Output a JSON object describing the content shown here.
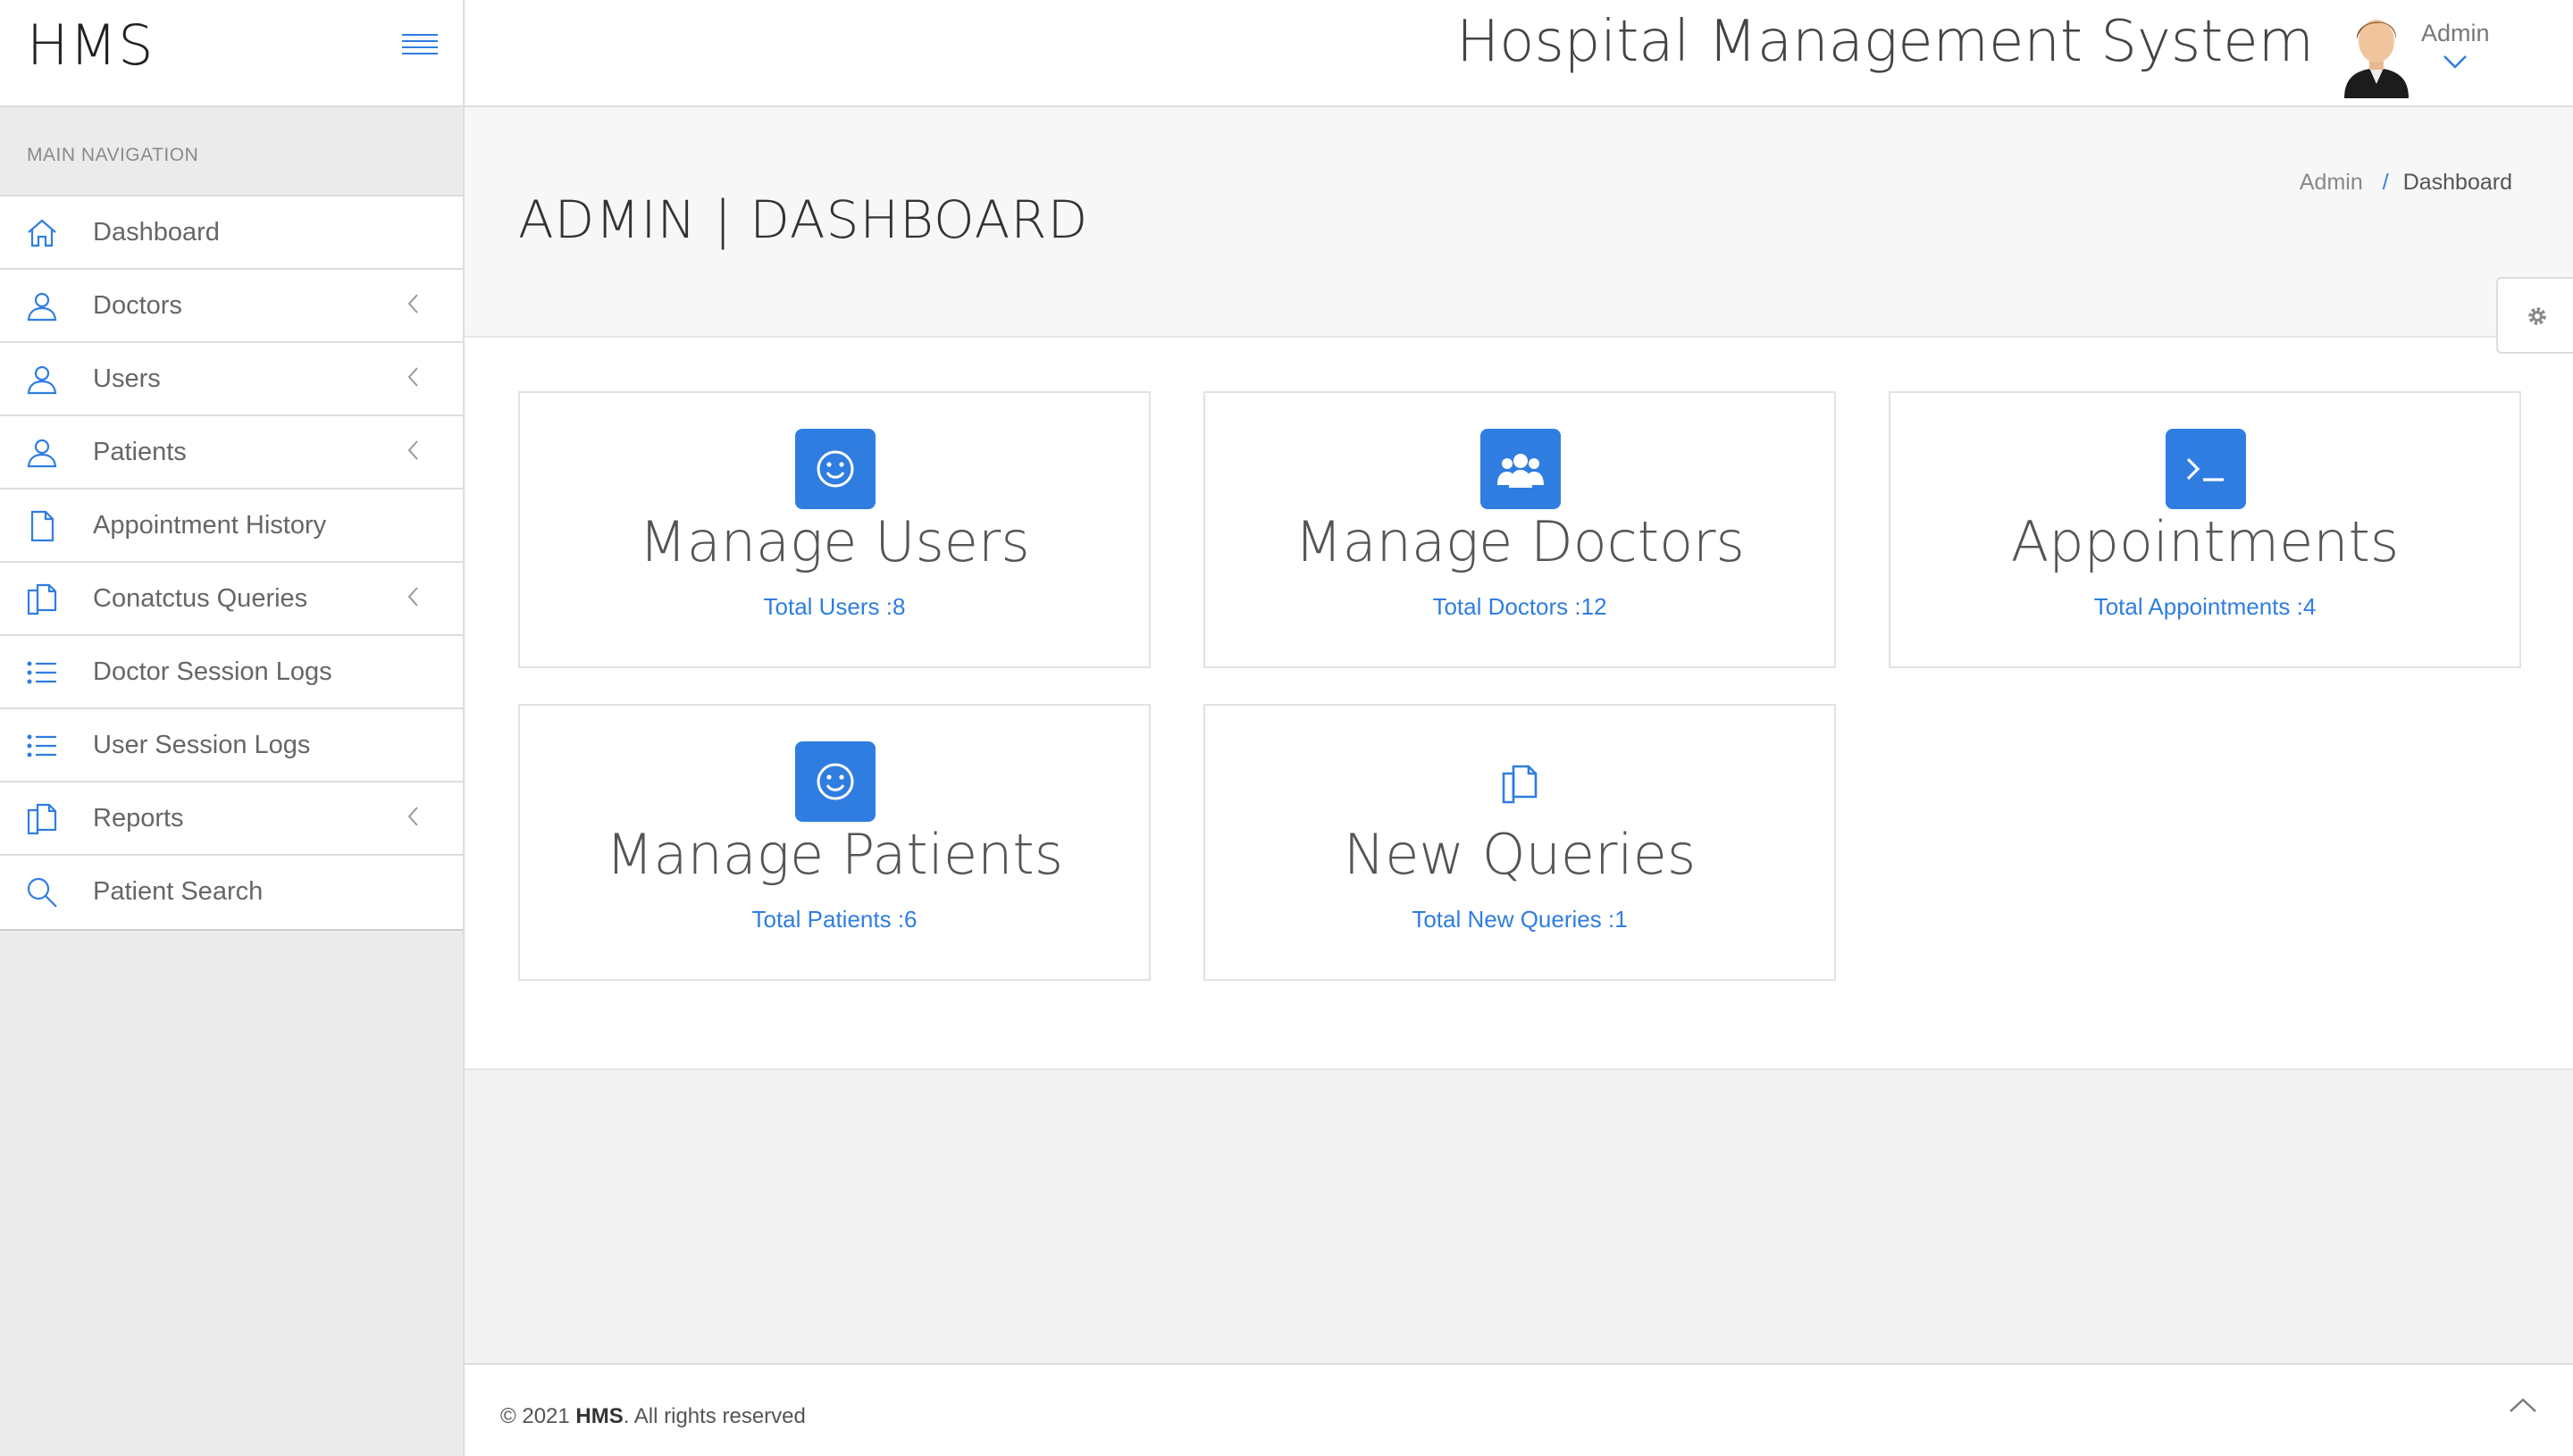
{
  "header": {
    "brand": "HMS",
    "system_title": "Hospital Management System",
    "user_name": "Admin"
  },
  "sidebar": {
    "section_title": "MAIN NAVIGATION",
    "items": [
      {
        "label": "Dashboard",
        "icon": "home-icon",
        "has_submenu": false
      },
      {
        "label": "Doctors",
        "icon": "user-icon",
        "has_submenu": true
      },
      {
        "label": "Users",
        "icon": "user-icon",
        "has_submenu": true
      },
      {
        "label": "Patients",
        "icon": "user-icon",
        "has_submenu": true
      },
      {
        "label": "Appointment History",
        "icon": "file-icon",
        "has_submenu": false
      },
      {
        "label": "Conatctus Queries",
        "icon": "files-icon",
        "has_submenu": true
      },
      {
        "label": "Doctor Session Logs",
        "icon": "list-icon",
        "has_submenu": false
      },
      {
        "label": "User Session Logs",
        "icon": "list-icon",
        "has_submenu": false
      },
      {
        "label": "Reports",
        "icon": "files-icon",
        "has_submenu": true
      },
      {
        "label": "Patient Search",
        "icon": "search-icon",
        "has_submenu": false
      }
    ]
  },
  "page": {
    "title": "ADMIN | DASHBOARD",
    "breadcrumb": [
      "Admin",
      "Dashboard"
    ]
  },
  "cards": [
    {
      "title": "Manage Users",
      "count_text": "Total Users :8",
      "icon": "smile-icon"
    },
    {
      "title": "Manage Doctors",
      "count_text": "Total Doctors :12",
      "icon": "users-group-icon"
    },
    {
      "title": "Appointments",
      "count_text": "Total Appointments :4",
      "icon": "terminal-icon"
    },
    {
      "title": "Manage Patients",
      "count_text": "Total Patients :6",
      "icon": "smile-icon"
    },
    {
      "title": "New Queries",
      "count_text": "Total New Queries :1",
      "icon": "files-icon"
    }
  ],
  "footer": {
    "prefix": "© 2021 ",
    "brand": "HMS",
    "suffix": ". All rights reserved"
  },
  "colors": {
    "accent": "#2f7de1",
    "sidebar_bg": "#ebebeb"
  }
}
